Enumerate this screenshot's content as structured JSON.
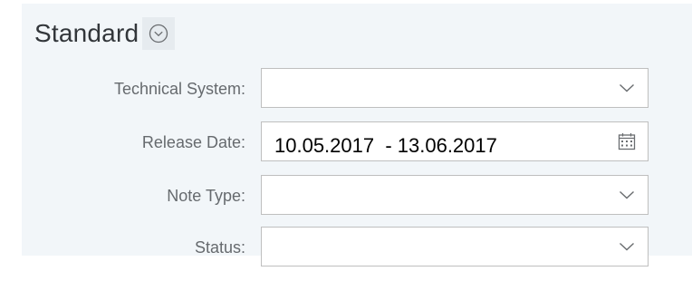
{
  "filter_bar": {
    "variant_title": "Standard",
    "variant_icon": "chevron-down-circle-icon",
    "fields": [
      {
        "label": "Technical System:",
        "value": "",
        "control": "dropdown",
        "icon": "chevron-down-icon"
      },
      {
        "label": "Release Date:",
        "value": "10.05.2017  - 13.06.2017",
        "control": "date-range",
        "icon": "calendar-icon"
      },
      {
        "label": "Note Type:",
        "value": "",
        "control": "dropdown",
        "icon": "chevron-down-icon"
      },
      {
        "label": "Status:",
        "value": "",
        "control": "dropdown",
        "icon": "chevron-down-icon"
      }
    ]
  },
  "colors": {
    "panel_background": "#f2f6f9",
    "field_border": "#bfbfbf",
    "label_text": "#666a6e",
    "icon": "#6a6d70"
  }
}
